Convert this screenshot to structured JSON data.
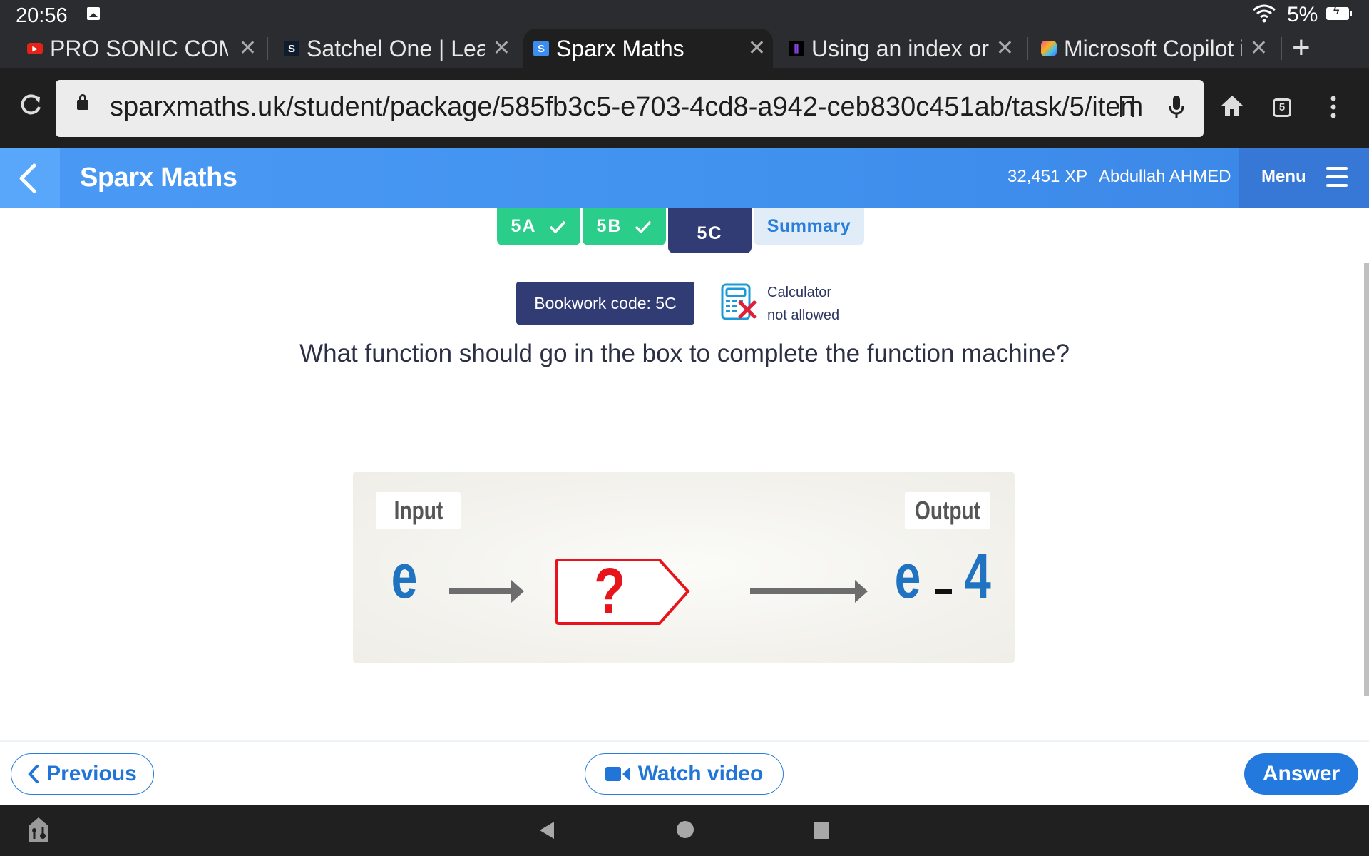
{
  "status_bar": {
    "time": "20:56",
    "battery_percent": "5%"
  },
  "browser": {
    "tabs": [
      {
        "label": "PRO SONIC COMBO",
        "favicon": "youtube-icon",
        "active": false
      },
      {
        "label": "Satchel One | Learn",
        "favicon": "satchel-icon",
        "favicon_text": "S",
        "active": false
      },
      {
        "label": "Sparx Maths",
        "favicon": "sparx-icon",
        "favicon_text": "S",
        "active": true
      },
      {
        "label": "Using an index or p",
        "favicon": "book-icon",
        "active": false
      },
      {
        "label": "Microsoft Copilot i",
        "favicon": "copilot-icon",
        "active": false
      }
    ],
    "close_glyph": "✕",
    "new_tab_glyph": "+",
    "url": "sparxmaths.uk/student/package/585fb3c5-e703-4cd8-a942-ceb830c451ab/task/5/item",
    "tab_count": "5"
  },
  "app_header": {
    "title": "Sparx Maths",
    "xp": "32,451 XP",
    "user_name": "Abdullah AHMED",
    "menu_label": "Menu"
  },
  "task_tabs": [
    {
      "label": "5A",
      "status": "complete"
    },
    {
      "label": "5B",
      "status": "complete"
    },
    {
      "label": "5C",
      "status": "current"
    },
    {
      "label": "Summary",
      "status": "summary"
    }
  ],
  "bookwork": {
    "label": "Bookwork code: 5C"
  },
  "calculator": {
    "line1": "Calculator",
    "line2": "not allowed"
  },
  "question": {
    "text": "What function should go in the box to complete the function machine?"
  },
  "function_machine": {
    "input_label": "Input",
    "output_label": "Output",
    "input_value": "e",
    "machine_value": "?",
    "output_var": "e",
    "output_op": "−",
    "output_num": "4"
  },
  "footer": {
    "previous_label": "Previous",
    "watch_video_label": "Watch video",
    "answer_label": "Answer"
  },
  "colors": {
    "header_blue": "#4a9af5",
    "complete_green": "#2bcd8a",
    "current_navy": "#313b74",
    "accent_blue": "#2479df",
    "machine_red": "#e8141c",
    "math_blue": "#1f73c1"
  }
}
